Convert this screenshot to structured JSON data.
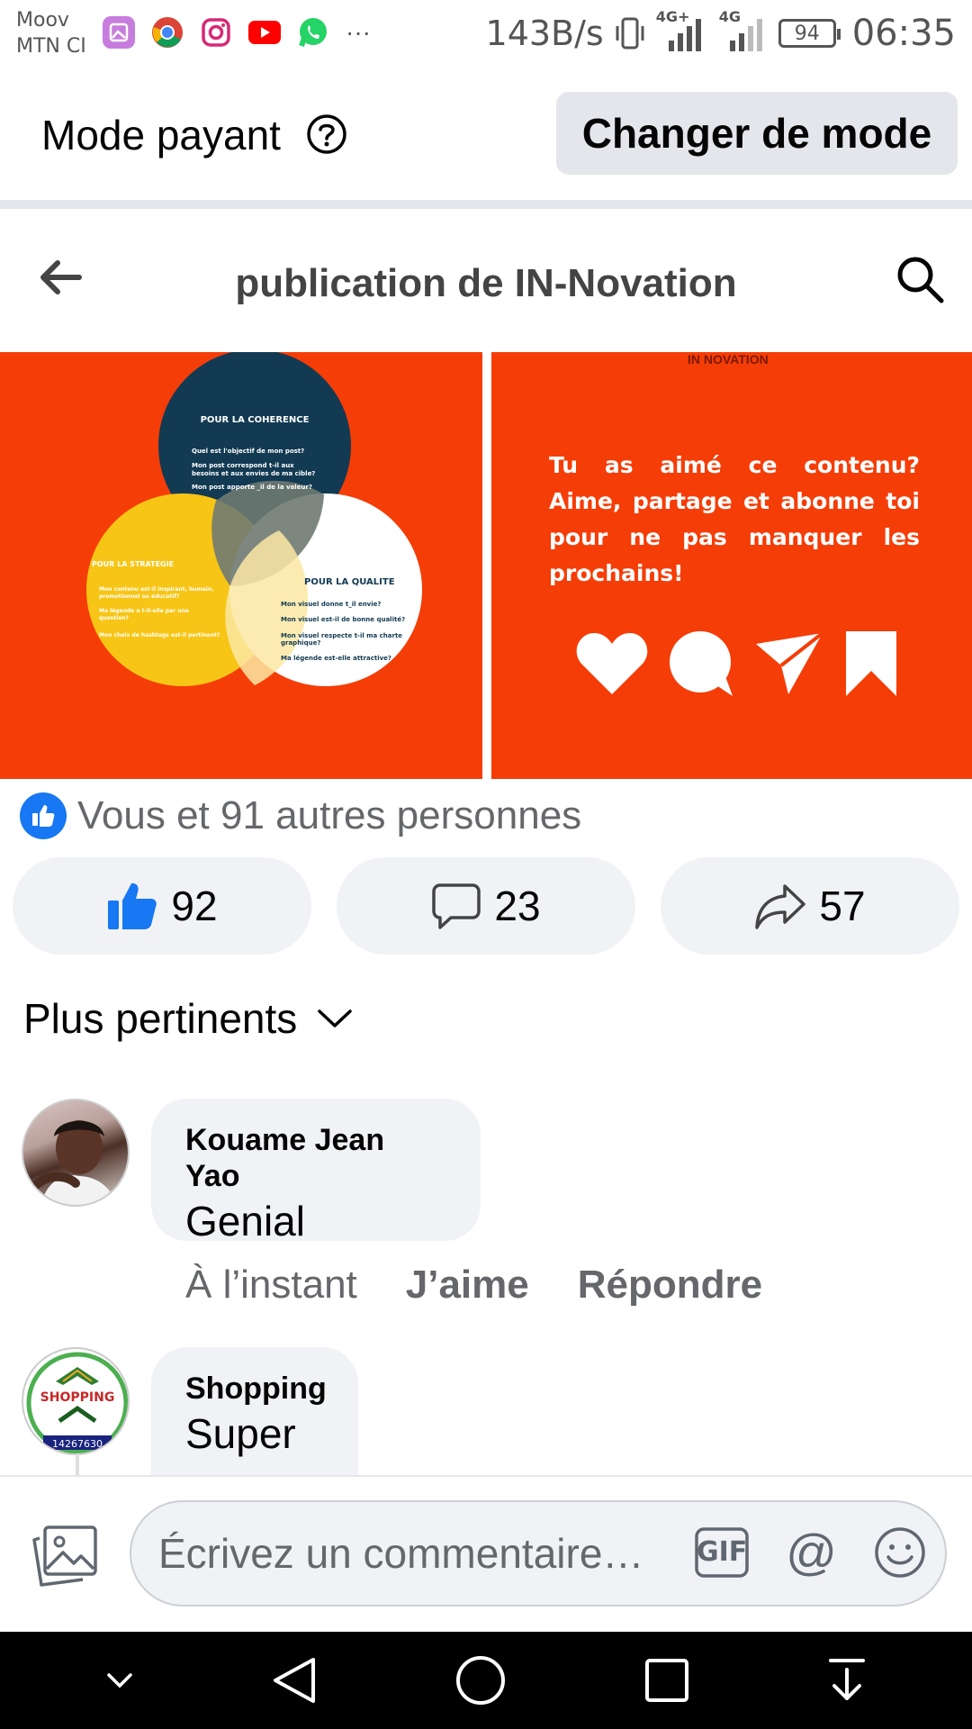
{
  "status_bar": {
    "carrier_line1": "Moov",
    "carrier_line2": "MTN CI",
    "net_speed": "143B/s",
    "signal_label_1": "4G+",
    "signal_label_2": "4G",
    "battery": "94",
    "time": "06:35",
    "more_apps": "···"
  },
  "mode_bar": {
    "label": "Mode payant",
    "help_icon": "question-circle-icon",
    "change_button": "Changer de mode"
  },
  "header": {
    "title": "publication de IN-Novation",
    "back_icon": "arrow-left-icon",
    "search_icon": "search-icon"
  },
  "media": {
    "left": {
      "circle_top_title": "POUR LA COHERENCE",
      "circle_top_lines": [
        "Quel est l'objectif de mon post?",
        "Mon post correspond t-il aux",
        "besoins et aux envies de ma cible?",
        "Mon post apporte _il de la valeur?"
      ],
      "circle_left_title": "POUR LA STRATEGIE",
      "circle_left_lines": [
        "Mon contenu est-il inspirant, humain,",
        "promotionnel ou éducatif?",
        "Ma légende a t-il-elle par une",
        "question?",
        "Mon choix de hashtags est-il pertinent?"
      ],
      "circle_right_title": "POUR LA QUALITE",
      "circle_right_lines": [
        "Mon visuel donne t_il envie?",
        "Mon visuel est-il de bonne qualité?",
        "Mon visuel respecte t-il ma charte",
        "graphique?",
        "Ma légende est-elle attractive?"
      ],
      "colors": {
        "background": "#f53d07",
        "top": "#123a52",
        "left": "#f7c515",
        "right": "#ffffff"
      }
    },
    "right": {
      "logo": "IN NOVATION",
      "cta_text": "Tu as aimé ce contenu? Aime, partage et abonne toi pour ne pas manquer les prochains!",
      "icons": [
        "heart-icon",
        "speech-bubble-icon",
        "paper-plane-icon",
        "bookmark-icon"
      ]
    }
  },
  "reactions": {
    "summary": "Vous et 91 autres personnes",
    "likes": "92",
    "comments": "23",
    "shares": "57"
  },
  "sort": {
    "label": "Plus pertinents"
  },
  "comments": [
    {
      "author": "Kouame Jean Yao",
      "text": "Genial",
      "time": "À l’instant",
      "like_label": "J’aime",
      "reply_label": "Répondre"
    },
    {
      "author": "Shopping",
      "text": "Super",
      "avatar_text": "SHOPPING",
      "avatar_number": "14267630"
    }
  ],
  "composer": {
    "placeholder": "Écrivez un commentaire…",
    "gif_label": "GIF",
    "mention_label": "@"
  },
  "colors": {
    "accent": "#1877f2",
    "bubble_bg": "#f0f2f5",
    "secondary_text": "#65676b",
    "brand_orange": "#f53d07"
  }
}
